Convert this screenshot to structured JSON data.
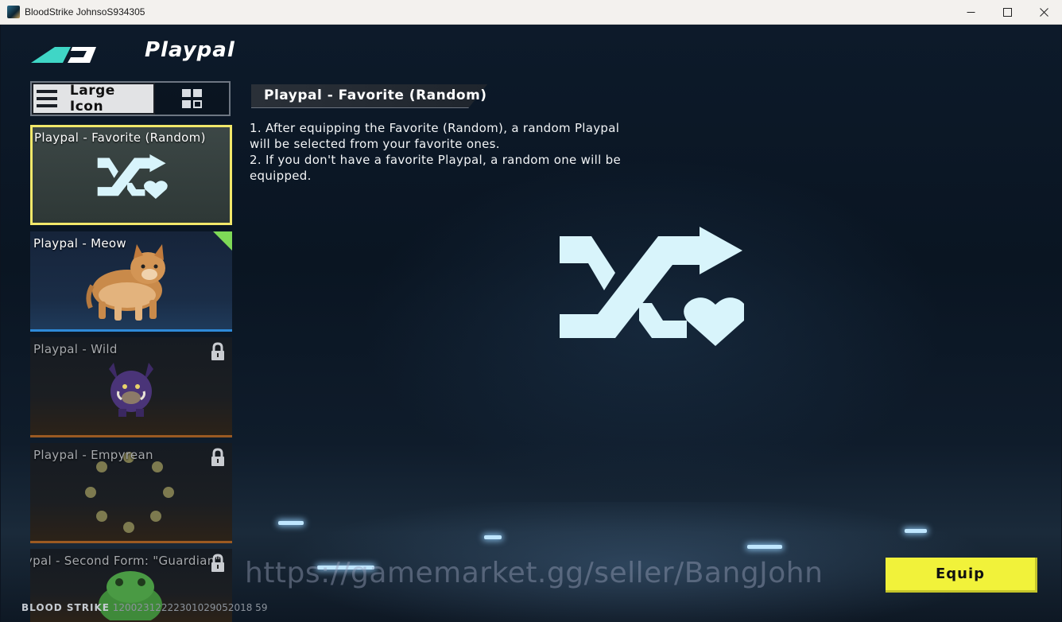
{
  "window": {
    "title": "BloodStrike JohnsoS934305"
  },
  "header": {
    "title": "Playpal"
  },
  "view_toggle": {
    "large_icon_label": "Large Icon",
    "active": "large-icon"
  },
  "cards": [
    {
      "label": "Playpal - Favorite (Random)",
      "state": "selected"
    },
    {
      "label": "Playpal - Meow",
      "state": "owned-new"
    },
    {
      "label": "Playpal - Wild",
      "state": "locked"
    },
    {
      "label": "Playpal - Empyrean",
      "state": "locked"
    },
    {
      "label": "ypal - Second Form: \"Guardian\"",
      "state": "locked"
    }
  ],
  "detail": {
    "title": "Playpal - Favorite (Random)",
    "line1": "1. After equipping the Favorite (Random), a random Playpal will be selected from your favorite ones.",
    "line2": "2. If you don't have a favorite Playpal, a random one will be equipped."
  },
  "actions": {
    "equip_label": "Equip"
  },
  "watermark": "https://gamemarket.gg/seller/BangJohn",
  "footer": {
    "brand": "BLOOD STRIKE",
    "id": "12002312222301029052018 59"
  },
  "colors": {
    "selected_border": "#f2e86a",
    "equip_button": "#f1f23a",
    "shuffle_icon": "#d8f4fb",
    "new_corner": "#7ed957",
    "owned_border": "#2e8ad9",
    "locked_border": "#9b5a22"
  }
}
